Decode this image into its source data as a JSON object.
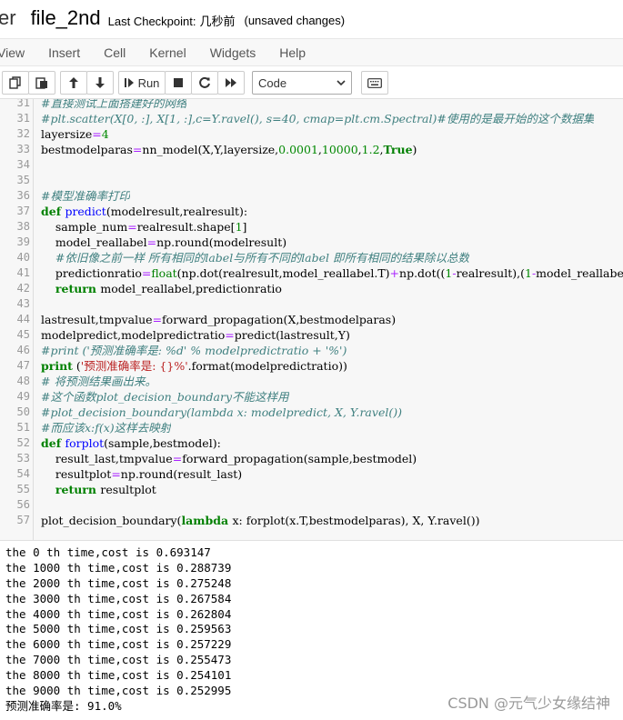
{
  "header": {
    "logo_tail": "er",
    "notebook_name": "file_2nd",
    "checkpoint_label": "Last Checkpoint:",
    "checkpoint_time": "几秒前",
    "save_status": "(unsaved changes)"
  },
  "menu": [
    "View",
    "Insert",
    "Cell",
    "Kernel",
    "Widgets",
    "Help"
  ],
  "toolbar": {
    "copy_icon": "copy-icon",
    "paste_icon": "paste-icon",
    "run_label": "Run",
    "cell_type": "Code",
    "cell_type_options": [
      "Code"
    ]
  },
  "code": [
    {
      "n": "31",
      "parts": [
        {
          "t": "#直接测试上面搭建好的网络",
          "c": "cm"
        }
      ]
    },
    {
      "n": "31",
      "parts": [
        {
          "t": "#plt.scatter(X[0, :], X[1, :],c=Y.ravel(), s=40, cmap=plt.cm.Spectral)#使用的是最开始的这个数据集",
          "c": "cm"
        }
      ]
    },
    {
      "n": "32",
      "parts": [
        {
          "t": "layersize",
          "c": ""
        },
        {
          "t": "=",
          "c": "op"
        },
        {
          "t": "4",
          "c": "num"
        }
      ]
    },
    {
      "n": "33",
      "parts": [
        {
          "t": "bestmodelparas",
          "c": ""
        },
        {
          "t": "=",
          "c": "op"
        },
        {
          "t": "nn_model(X,Y,layersize,",
          "c": ""
        },
        {
          "t": "0.0001",
          "c": "num"
        },
        {
          "t": ",",
          "c": ""
        },
        {
          "t": "10000",
          "c": "num"
        },
        {
          "t": ",",
          "c": ""
        },
        {
          "t": "1.2",
          "c": "num"
        },
        {
          "t": ",",
          "c": ""
        },
        {
          "t": "True",
          "c": "kw"
        },
        {
          "t": ")",
          "c": ""
        }
      ]
    },
    {
      "n": "34",
      "parts": []
    },
    {
      "n": "35",
      "parts": []
    },
    {
      "n": "36",
      "parts": [
        {
          "t": "#模型准确率打印",
          "c": "cm"
        }
      ]
    },
    {
      "n": "37",
      "parts": [
        {
          "t": "def ",
          "c": "kw"
        },
        {
          "t": "predict",
          "c": "fn"
        },
        {
          "t": "(modelresult,realresult):",
          "c": ""
        }
      ]
    },
    {
      "n": "38",
      "parts": [
        {
          "t": "    sample_num",
          "c": ""
        },
        {
          "t": "=",
          "c": "op"
        },
        {
          "t": "realresult.shape[",
          "c": ""
        },
        {
          "t": "1",
          "c": "num"
        },
        {
          "t": "]",
          "c": ""
        }
      ]
    },
    {
      "n": "39",
      "parts": [
        {
          "t": "    model_reallabel",
          "c": ""
        },
        {
          "t": "=",
          "c": "op"
        },
        {
          "t": "np.round(modelresult)",
          "c": ""
        }
      ]
    },
    {
      "n": "40",
      "parts": [
        {
          "t": "    #依旧像之前一样 所有相同的label与所有不同的label 即所有相同的结果除以总数",
          "c": "cm"
        }
      ]
    },
    {
      "n": "41",
      "parts": [
        {
          "t": "    predictionratio",
          "c": ""
        },
        {
          "t": "=",
          "c": "op"
        },
        {
          "t": "float",
          "c": "bi"
        },
        {
          "t": "(np.dot(realresult,model_reallabel.T)",
          "c": ""
        },
        {
          "t": "+",
          "c": "op"
        },
        {
          "t": "np.dot((",
          "c": ""
        },
        {
          "t": "1",
          "c": "num"
        },
        {
          "t": "-",
          "c": "op"
        },
        {
          "t": "realresult),(",
          "c": ""
        },
        {
          "t": "1",
          "c": "num"
        },
        {
          "t": "-",
          "c": "op"
        },
        {
          "t": "model_reallabel).T))",
          "c": ""
        }
      ]
    },
    {
      "n": "42",
      "parts": [
        {
          "t": "    ",
          "c": ""
        },
        {
          "t": "return ",
          "c": "kw"
        },
        {
          "t": "model_reallabel,predictionratio",
          "c": ""
        }
      ]
    },
    {
      "n": "43",
      "parts": []
    },
    {
      "n": "44",
      "parts": [
        {
          "t": "lastresult,tmpvalue",
          "c": ""
        },
        {
          "t": "=",
          "c": "op"
        },
        {
          "t": "forward_propagation(X,bestmodelparas)",
          "c": ""
        }
      ]
    },
    {
      "n": "45",
      "parts": [
        {
          "t": "modelpredict,modelpredictratio",
          "c": ""
        },
        {
          "t": "=",
          "c": "op"
        },
        {
          "t": "predict(lastresult,Y)",
          "c": ""
        }
      ]
    },
    {
      "n": "46",
      "parts": [
        {
          "t": "#print ('预测准确率是: %d' % modelpredictratio + '%')",
          "c": "cm"
        }
      ]
    },
    {
      "n": "47",
      "parts": [
        {
          "t": "print",
          "c": "kw"
        },
        {
          "t": " (",
          "c": ""
        },
        {
          "t": "'预测准确率是: {}%'",
          "c": "str"
        },
        {
          "t": ".format(modelpredictratio))",
          "c": ""
        }
      ]
    },
    {
      "n": "48",
      "parts": [
        {
          "t": "# 将预测结果画出来。",
          "c": "cm"
        }
      ]
    },
    {
      "n": "49",
      "parts": [
        {
          "t": "#这个函数plot_decision_boundary不能这样用",
          "c": "cm"
        }
      ]
    },
    {
      "n": "50",
      "parts": [
        {
          "t": "#plot_decision_boundary(lambda x: modelpredict, X, Y.ravel())",
          "c": "cm"
        }
      ]
    },
    {
      "n": "51",
      "parts": [
        {
          "t": "#而应该x:f(x)这样去映射",
          "c": "cm"
        }
      ]
    },
    {
      "n": "52",
      "parts": [
        {
          "t": "def ",
          "c": "kw"
        },
        {
          "t": "forplot",
          "c": "fn"
        },
        {
          "t": "(sample,bestmodel):",
          "c": ""
        }
      ]
    },
    {
      "n": "53",
      "parts": [
        {
          "t": "    result_last,tmpvalue",
          "c": ""
        },
        {
          "t": "=",
          "c": "op"
        },
        {
          "t": "forward_propagation(sample,bestmodel)",
          "c": ""
        }
      ]
    },
    {
      "n": "54",
      "parts": [
        {
          "t": "    resultplot",
          "c": ""
        },
        {
          "t": "=",
          "c": "op"
        },
        {
          "t": "np.round(result_last)",
          "c": ""
        }
      ]
    },
    {
      "n": "55",
      "parts": [
        {
          "t": "    ",
          "c": ""
        },
        {
          "t": "return ",
          "c": "kw"
        },
        {
          "t": "resultplot",
          "c": ""
        }
      ]
    },
    {
      "n": "56",
      "parts": []
    },
    {
      "n": "57",
      "parts": [
        {
          "t": "plot_decision_boundary(",
          "c": ""
        },
        {
          "t": "lambda ",
          "c": "kw"
        },
        {
          "t": "x: forplot(x.T,bestmodelparas), X, Y.ravel())",
          "c": ""
        }
      ]
    }
  ],
  "output": [
    "the 0 th time,cost is 0.693147",
    "the 1000 th time,cost is 0.288739",
    "the 2000 th time,cost is 0.275248",
    "the 3000 th time,cost is 0.267584",
    "the 4000 th time,cost is 0.262804",
    "the 5000 th time,cost is 0.259563",
    "the 6000 th time,cost is 0.257229",
    "the 7000 th time,cost is 0.255473",
    "the 8000 th time,cost is 0.254101",
    "the 9000 th time,cost is 0.252995",
    "预测准确率是: 91.0%"
  ],
  "watermark": "CSDN @元气少女缘结神"
}
